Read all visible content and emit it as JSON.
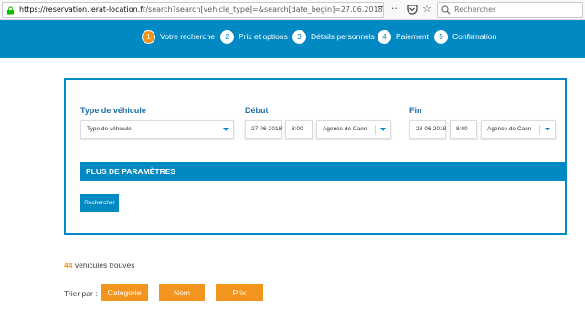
{
  "browser": {
    "url_domain": "https://reservation.lerat-location.fr",
    "url_path": "/search?search[vehicle_type]=&search[date_begin]=27.06.2018&search[hours_begin",
    "search_placeholder": "Rechercher"
  },
  "steps": [
    {
      "num": "1",
      "label": "Votre recherche",
      "active": true
    },
    {
      "num": "2",
      "label": "Prix et options",
      "active": false
    },
    {
      "num": "3",
      "label": "Détails personnels",
      "active": false
    },
    {
      "num": "4",
      "label": "Paiement",
      "active": false
    },
    {
      "num": "5",
      "label": "Confirmation",
      "active": false
    }
  ],
  "form": {
    "vehicle_type_label": "Type de véhicule",
    "vehicle_type_value": "Type de véhicule",
    "begin_label": "Début",
    "begin_date": "27-06-2018",
    "begin_time": "8:00",
    "begin_agency": "Agence de Caen",
    "end_label": "Fin",
    "end_date": "28-06-2018",
    "end_time": "8:00",
    "end_agency": "Agence de Caen",
    "more_params": "PLUS DE PARAMÈTRES",
    "search_button": "Rechercher"
  },
  "results": {
    "count": "44",
    "text": "véhicules trouvés"
  },
  "sort": {
    "label": "Trier par :",
    "options": [
      "Catégorie",
      "Nom",
      "Prix"
    ]
  },
  "colors": {
    "brand_blue": "#0089c3",
    "accent_orange": "#f3941e"
  }
}
